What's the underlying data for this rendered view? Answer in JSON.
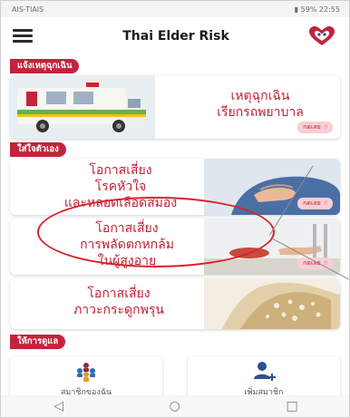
{
  "status_bar": {
    "carrier": "AIS-TIAIS",
    "right": "59% 22:55"
  },
  "app": {
    "title": "Thai Elder Risk"
  },
  "sections": {
    "emergency": "แจ้งเหตุฉุกเฉิน",
    "self_care": "ใส่ใจตัวเอง",
    "care": "ให้การดูแล"
  },
  "cards": {
    "ambulance": {
      "line1": "เหตุฉุกเฉิน",
      "line2": "เรียกรถพยาบาล",
      "button": "กดเลย"
    },
    "heart": {
      "line1": "โอกาสเสี่ยง",
      "line2": "โรคหัวใจ",
      "line3": "และหลอดเลือดสมอง",
      "button": "กดเลย"
    },
    "fall": {
      "line1": "โอกาสเสี่ยง",
      "line2": "การพลัดตกหกล้ม",
      "line3": "ในผู้สูงอายุ",
      "button": "กดเลย"
    },
    "bone": {
      "line1": "โอกาสเสี่ยง",
      "line2": "ภาวะกระดูกพรุน"
    }
  },
  "tiles": {
    "members": "สมาชิกของฉัน",
    "add_member": "เพิ่มสมาชิก"
  },
  "colors": {
    "accent": "#c4233d",
    "highlight": "#d8222a"
  }
}
